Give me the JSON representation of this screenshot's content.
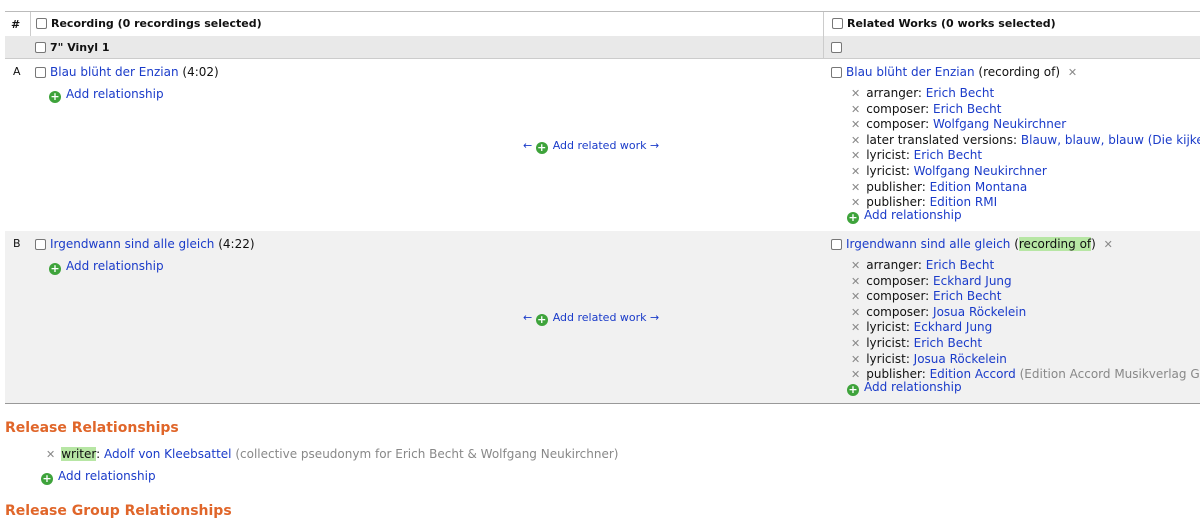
{
  "header": {
    "num": "#",
    "recording": "Recording (0 recordings selected)",
    "works": "Related Works (0 works selected)"
  },
  "medium": {
    "title": "7\" Vinyl 1"
  },
  "rows": [
    {
      "label": "A",
      "recording": "Blau blüht der Enzian",
      "length": "(4:02)",
      "add_relationship": "Add relationship",
      "add_related_work": "Add related work",
      "arrow_left": "←",
      "arrow_right": "→",
      "work": {
        "title": "Blau blüht der Enzian",
        "type": "recording of",
        "relationships": [
          {
            "role": "arranger",
            "target": "Erich Becht"
          },
          {
            "role": "composer",
            "target": "Erich Becht"
          },
          {
            "role": "composer",
            "target": "Wolfgang Neukirchner"
          },
          {
            "role": "later translated versions",
            "target": "Blauw, blauw, blauw (Die kijke"
          },
          {
            "role": "lyricist",
            "target": "Erich Becht"
          },
          {
            "role": "lyricist",
            "target": "Wolfgang Neukirchner"
          },
          {
            "role": "publisher",
            "target": "Edition Montana"
          },
          {
            "role": "publisher",
            "target": "Edition RMI"
          }
        ],
        "add_relationship": "Add relationship"
      }
    },
    {
      "label": "B",
      "recording": "Irgendwann sind alle gleich",
      "length": "(4:22)",
      "add_relationship": "Add relationship",
      "add_related_work": "Add related work",
      "arrow_left": "←",
      "arrow_right": "→",
      "work": {
        "title": "Irgendwann sind alle gleich",
        "type": "recording of",
        "relationships": [
          {
            "role": "arranger",
            "target": "Erich Becht"
          },
          {
            "role": "composer",
            "target": "Eckhard Jung"
          },
          {
            "role": "composer",
            "target": "Erich Becht"
          },
          {
            "role": "composer",
            "target": "Josua Röckelein"
          },
          {
            "role": "lyricist",
            "target": "Eckhard Jung"
          },
          {
            "role": "lyricist",
            "target": "Erich Becht"
          },
          {
            "role": "lyricist",
            "target": "Josua Röckelein"
          },
          {
            "role": "publisher",
            "target": "Edition Accord",
            "note": "(Edition Accord Musikverlag Gr"
          }
        ],
        "add_relationship": "Add relationship"
      }
    }
  ],
  "release_relationships": {
    "heading": "Release Relationships",
    "role": "writer",
    "target": "Adolf von Kleebsattel",
    "note": "(collective pseudonym for Erich Becht & Wolfgang Neukirchner)",
    "add_relationship": "Add relationship"
  },
  "release_group_relationships": {
    "heading": "Release Group Relationships"
  },
  "colors": {
    "link": "#1a3bc9",
    "heading": "#e0662a",
    "highlight": "#b7e6a4",
    "add_icon": "#3ea33b"
  },
  "icons": {
    "add": "plus-circle-icon",
    "remove": "x-icon"
  }
}
